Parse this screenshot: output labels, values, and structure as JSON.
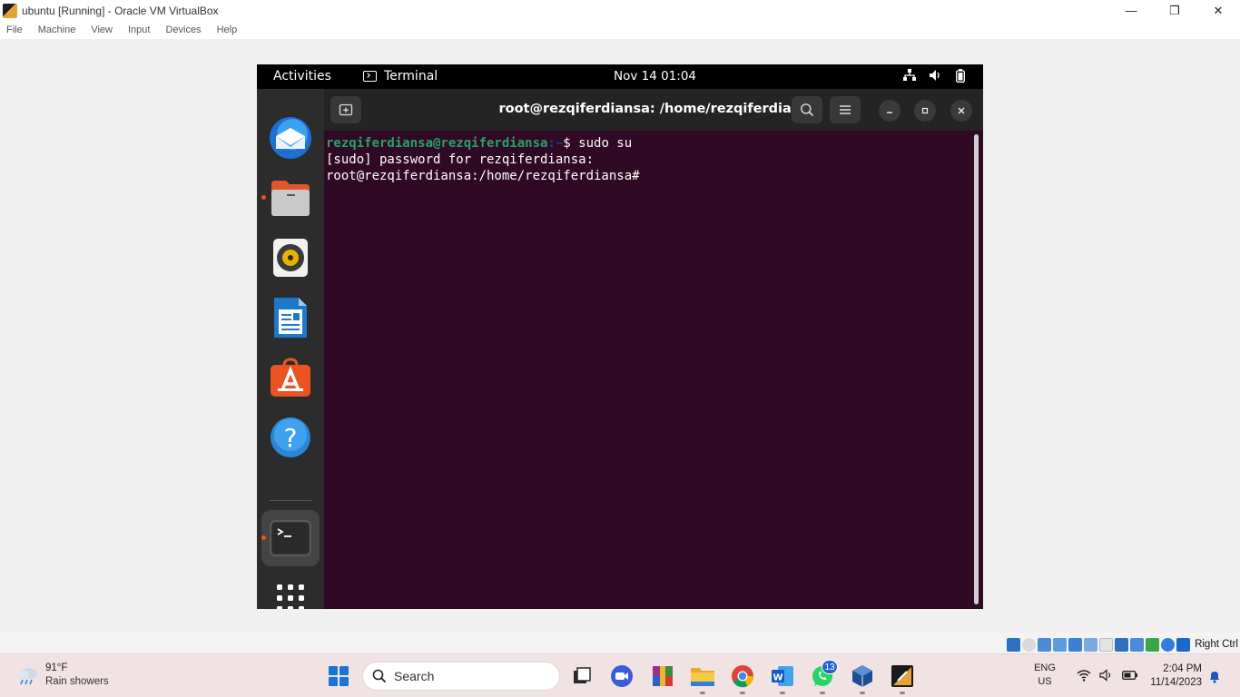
{
  "host_window": {
    "title": "ubuntu [Running] - Oracle VM VirtualBox",
    "menu": [
      "File",
      "Machine",
      "View",
      "Input",
      "Devices",
      "Help"
    ],
    "controls": {
      "minimize": "—",
      "maximize": "❐",
      "close": "✕"
    }
  },
  "guest": {
    "topbar": {
      "activities": "Activities",
      "app_name": "Terminal",
      "clock": "Nov 14  01:04",
      "tray_icons": [
        "network-icon",
        "volume-icon",
        "battery-icon"
      ]
    },
    "dock": {
      "items": [
        "thunderbird-icon",
        "files-icon",
        "rhythmbox-icon",
        "libreoffice-writer-icon",
        "app-center-icon",
        "help-icon",
        "terminal-icon",
        "show-apps-icon"
      ],
      "accent": "#e95420"
    },
    "terminal": {
      "title": "root@rezqiferdiansa: /home/rezqiferdiansa",
      "lines": [
        {
          "user": "rezqiferdiansa@rezqiferdiansa",
          "path": ":~",
          "cmd": "$ sudo su"
        },
        {
          "text": "[sudo] password for rezqiferdiansa:"
        },
        {
          "text": "root@rezqiferdiansa:/home/rezqiferdiansa#"
        }
      ],
      "colors": {
        "background": "#300a24",
        "prompt_user": "#26a269",
        "prompt_path": "#12488b"
      }
    }
  },
  "vbox_status": {
    "host_key": "Right Ctrl"
  },
  "taskbar": {
    "weather": {
      "temp": "91°F",
      "desc": "Rain showers"
    },
    "search_placeholder": "Search",
    "apps": [
      "start-icon",
      "task-view-icon",
      "zoom-icon",
      "winrar-icon",
      "file-explorer-icon",
      "chrome-icon",
      "word-icon",
      "whatsapp-icon",
      "virtualbox-icon",
      "vbox-app-icon"
    ],
    "whatsapp_badge": "13",
    "language": {
      "line1": "ENG",
      "line2": "US"
    },
    "time": "2:04 PM",
    "date": "11/14/2023"
  }
}
